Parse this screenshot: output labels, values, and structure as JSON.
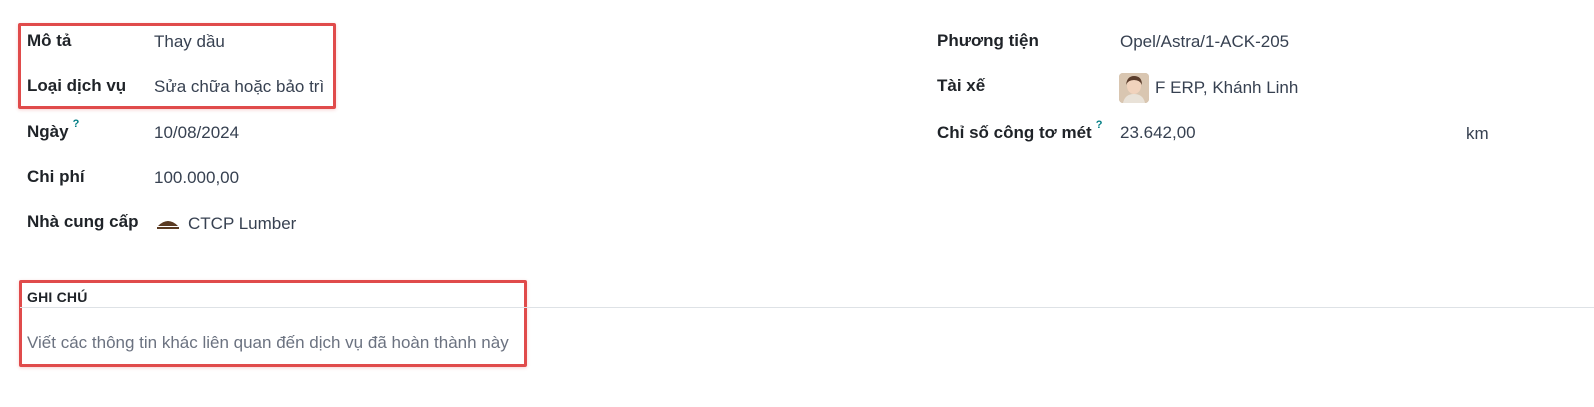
{
  "form": {
    "left": {
      "description_label": "Mô tả",
      "description_value": "Thay dầu",
      "service_type_label": "Loại dịch vụ",
      "service_type_value": "Sửa chữa hoặc bảo trì",
      "date_label": "Ngày",
      "date_help": "?",
      "date_value": "10/08/2024",
      "cost_label": "Chi phí",
      "cost_value": "100.000,00",
      "vendor_label": "Nhà cung cấp",
      "vendor_value": "CTCP Lumber"
    },
    "right": {
      "vehicle_label": "Phương tiện",
      "vehicle_value": "Opel/Astra/1-ACK-205",
      "driver_label": "Tài xế",
      "driver_value": "F ERP, Khánh Linh",
      "odometer_label": "Chỉ số công tơ mét",
      "odometer_help": "?",
      "odometer_value": "23.642,00",
      "odometer_unit": "km"
    },
    "notes": {
      "title": "GHI CHÚ",
      "placeholder": "Viết các thông tin khác liên quan đến dịch vụ đã hoàn thành này"
    }
  },
  "colors": {
    "highlight": "#e04b4b",
    "help_accent": "#017e84"
  },
  "icons": {
    "vendor": "vendor-logo-icon",
    "driver": "driver-avatar"
  }
}
